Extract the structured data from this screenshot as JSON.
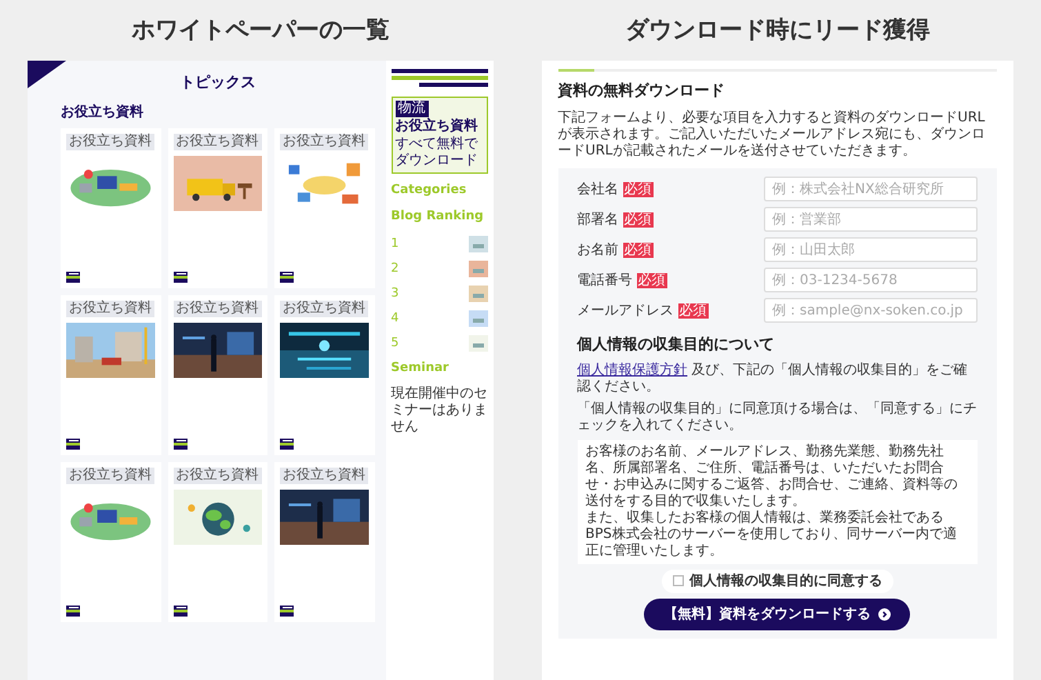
{
  "left": {
    "heading": "ホワイトペーパーの一覧",
    "title": "トピックス",
    "section": "お役立ち資料",
    "cards": [
      {
        "tag": "お役立ち資料",
        "kind": "picture"
      },
      {
        "tag": "お役立ち資料",
        "kind": "picture"
      },
      {
        "tag": "お役立ち資料",
        "kind": "picture"
      },
      {
        "tag": "お役立ち資料",
        "kind": "picture"
      },
      {
        "tag": "お役立ち資料",
        "kind": "picture"
      },
      {
        "tag": "お役立ち資料",
        "kind": "picture"
      },
      {
        "tag": "お役立ち資料",
        "kind": "picture"
      },
      {
        "tag": "お役立ち資料",
        "kind": "picture"
      },
      {
        "tag": "お役立ち資料",
        "kind": "picture"
      }
    ],
    "sidebar": {
      "banner": {
        "badge": "物流",
        "title": "お役立ち資料",
        "subtitle": "すべて無料でダウンロード"
      },
      "categories": "Categories",
      "ranking_title": "Blog Ranking",
      "ranking": [
        "1",
        "2",
        "3",
        "4",
        "5"
      ],
      "seminar_title": "Seminar",
      "seminar_text": "現在開催中のセミナーはありません"
    }
  },
  "right": {
    "heading": "ダウンロード時にリード獲得",
    "title": "資料の無料ダウンロード",
    "intro": "下記フォームより、必要な項目を入力すると資料のダウンロードURLが表示されます。ご記入いただいたメールアドレス宛にも、ダウンロードURLが記載されたメールを送付させていただきます。",
    "fields": [
      {
        "label": "会社名",
        "badge": "必須",
        "placeholder": "例：株式会社NX総合研究所"
      },
      {
        "label": "部署名",
        "badge": "必須",
        "placeholder": "例：営業部"
      },
      {
        "label": "お名前",
        "badge": "必須",
        "placeholder": "例：山田太郎"
      },
      {
        "label": "電話番号",
        "badge": "必須",
        "placeholder": "例：03-1234-5678"
      },
      {
        "label": "メールアドレス",
        "badge": "必須",
        "placeholder": "例：sample@nx-soken.co.jp"
      }
    ],
    "privacy_title": "個人情報の収集目的について",
    "privacy_link": "個人情報保護方針",
    "privacy_line1": "及び、下記の「個人情報の収集目的」をご確認ください。",
    "privacy_line2": "「個人情報の収集目的」に同意頂ける場合は、「同意する」にチェックを入れてください。",
    "privacy_text": [
      "お客様のお名前、メールアドレス、勤務先業態、勤務先社名、所属部署名、ご住所、電話番号は、いただいたお問合せ・お申込みに関するご返答、お問合せ、ご連絡、資料等の送付をする目的で収集いたします。",
      "また、収集したお客様の個人情報は、業務委託会社であるBPS株式会社のサーバーを使用しており、同サーバー内で適正に管理いたします。"
    ],
    "consent": {
      "label": "個人情報の収集目的に同意する",
      "checked": false
    },
    "button": "【無料】資料をダウンロードする"
  }
}
